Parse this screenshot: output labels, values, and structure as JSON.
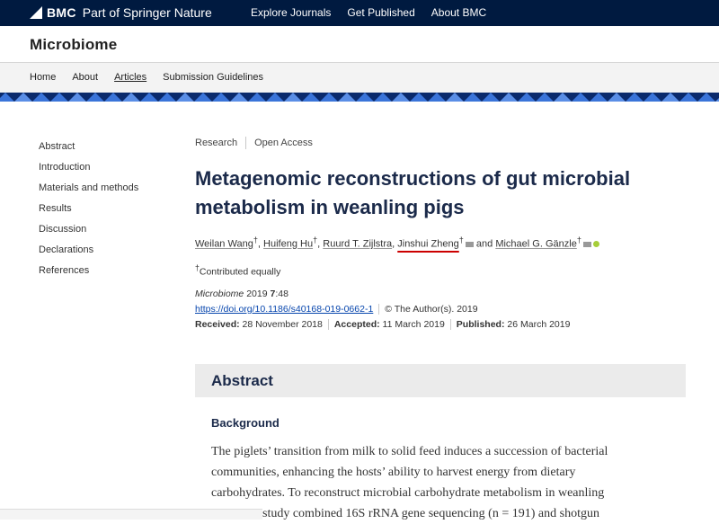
{
  "topbar": {
    "brand": "BMC",
    "tagline": "Part of Springer Nature",
    "nav": [
      "Explore Journals",
      "Get Published",
      "About BMC"
    ]
  },
  "journal": {
    "title": "Microbiome"
  },
  "subnav": [
    "Home",
    "About",
    "Articles",
    "Submission Guidelines"
  ],
  "toc": [
    "Abstract",
    "Introduction",
    "Materials and methods",
    "Results",
    "Discussion",
    "Declarations",
    "References"
  ],
  "article": {
    "type": "Research",
    "access": "Open Access",
    "title": "Metagenomic reconstructions of gut microbial metabolism in weanling pigs",
    "authors": [
      {
        "name": "Weilan Wang",
        "mark": "†"
      },
      {
        "name": "Huifeng Hu",
        "mark": "†"
      },
      {
        "name": "Ruurd T. Zijlstra"
      },
      {
        "name": "Jinshui Zheng",
        "mark": "†"
      },
      {
        "name": "Michael G. Gänzle",
        "mark": "†"
      }
    ],
    "and_text": "and",
    "contributed": "Contributed equally",
    "journal_name": "Microbiome",
    "year": "2019",
    "volume": "7",
    "article_no": ":48",
    "doi": "https://doi.org/10.1186/s40168-019-0662-1",
    "copyright": "© The Author(s). 2019",
    "received_label": "Received:",
    "received": "28 November 2018",
    "accepted_label": "Accepted:",
    "accepted": "11 March 2019",
    "published_label": "Published:",
    "published": "26 March 2019"
  },
  "abstract": {
    "heading": "Abstract",
    "background_heading": "Background",
    "text_lines": [
      "The piglets’ transition from milk to solid feed induces a succession of bacterial",
      "communities, enhancing the hosts’ ability to harvest energy from dietary",
      "carbohydrates. To reconstruct microbial carbohydrate metabolism in weanling",
      "study combined 16S rRNA gene sequencing (n = 191) and shotgun"
    ]
  }
}
